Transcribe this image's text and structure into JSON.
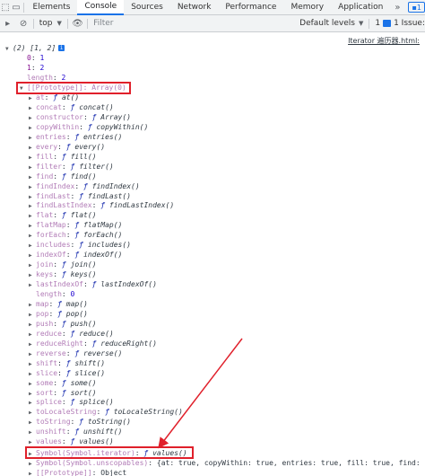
{
  "tabs": {
    "items": [
      "Elements",
      "Console",
      "Sources",
      "Network",
      "Performance",
      "Memory",
      "Application"
    ],
    "active": "Console",
    "more": "»",
    "issue_count": "1"
  },
  "toolbar": {
    "context": "top",
    "filter_placeholder": "Filter",
    "levels": "Default levels",
    "issue_text": "1 Issue: ",
    "issue_count": "1"
  },
  "console": {
    "source_link": "Iterator 遍历器.html:",
    "array_summary": "(2) [1, 2]",
    "info_icon": "i",
    "entries": [
      {
        "k": "0",
        "v": "1"
      },
      {
        "k": "1",
        "v": "2"
      },
      {
        "k": "length",
        "v": "2"
      }
    ],
    "prototype_label": "[[Prototype]]: Array(0)",
    "methods": [
      {
        "k": "at",
        "f": "at()"
      },
      {
        "k": "concat",
        "f": "concat()"
      },
      {
        "k": "constructor",
        "f": "Array()"
      },
      {
        "k": "copyWithin",
        "f": "copyWithin()"
      },
      {
        "k": "entries",
        "f": "entries()"
      },
      {
        "k": "every",
        "f": "every()"
      },
      {
        "k": "fill",
        "f": "fill()"
      },
      {
        "k": "filter",
        "f": "filter()"
      },
      {
        "k": "find",
        "f": "find()"
      },
      {
        "k": "findIndex",
        "f": "findIndex()"
      },
      {
        "k": "findLast",
        "f": "findLast()"
      },
      {
        "k": "findLastIndex",
        "f": "findLastIndex()"
      },
      {
        "k": "flat",
        "f": "flat()"
      },
      {
        "k": "flatMap",
        "f": "flatMap()"
      },
      {
        "k": "forEach",
        "f": "forEach()"
      },
      {
        "k": "includes",
        "f": "includes()"
      },
      {
        "k": "indexOf",
        "f": "indexOf()"
      },
      {
        "k": "join",
        "f": "join()"
      },
      {
        "k": "keys",
        "f": "keys()"
      },
      {
        "k": "lastIndexOf",
        "f": "lastIndexOf()"
      },
      {
        "k": "length",
        "plain": "0"
      },
      {
        "k": "map",
        "f": "map()"
      },
      {
        "k": "pop",
        "f": "pop()"
      },
      {
        "k": "push",
        "f": "push()"
      },
      {
        "k": "reduce",
        "f": "reduce()"
      },
      {
        "k": "reduceRight",
        "f": "reduceRight()"
      },
      {
        "k": "reverse",
        "f": "reverse()"
      },
      {
        "k": "shift",
        "f": "shift()"
      },
      {
        "k": "slice",
        "f": "slice()"
      },
      {
        "k": "some",
        "f": "some()"
      },
      {
        "k": "sort",
        "f": "sort()"
      },
      {
        "k": "splice",
        "f": "splice()"
      },
      {
        "k": "toLocaleString",
        "f": "toLocaleString()"
      },
      {
        "k": "toString",
        "f": "toString()"
      },
      {
        "k": "unshift",
        "f": "unshift()"
      },
      {
        "k": "values",
        "f": "values()"
      }
    ],
    "symbol_iterator": {
      "k": "Symbol(Symbol.iterator)",
      "f": "values()"
    },
    "symbol_unscopables": {
      "k": "Symbol(Symbol.unscopables)",
      "v": "{at: true, copyWithin: true, entries: true, fill: true, find: tr"
    },
    "inner_prototype": {
      "k": "[[Prototype]]",
      "v": "Object"
    },
    "f_glyph": "ƒ"
  },
  "colors": {
    "highlight": "#e0202b",
    "accent": "#1a73e8"
  }
}
